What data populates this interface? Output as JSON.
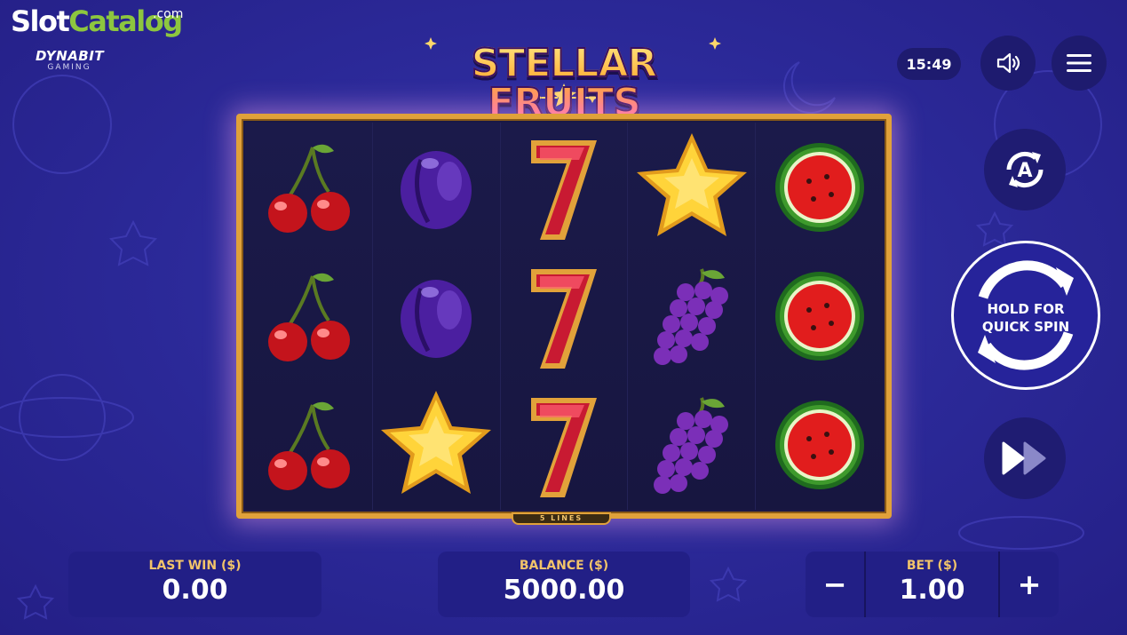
{
  "watermark": {
    "slot": "Slot",
    "catalog": "Catalog",
    "com": ".com"
  },
  "provider": {
    "name": "DYNABIT",
    "sub": "GAMING"
  },
  "game": {
    "title": "STELLAR FRUITS"
  },
  "clock": {
    "time": "15:49"
  },
  "controls": {
    "spin_label_line1": "HOLD FOR",
    "spin_label_line2": "QUICK SPIN"
  },
  "reels": {
    "lines_label": "5 LINES",
    "grid": [
      [
        "cherry",
        "plum",
        "seven",
        "star",
        "watermelon"
      ],
      [
        "cherry",
        "plum",
        "seven",
        "grapes",
        "watermelon"
      ],
      [
        "cherry",
        "star",
        "seven",
        "grapes",
        "watermelon"
      ]
    ]
  },
  "panels": {
    "last_win_label": "LAST WIN ($)",
    "last_win_value": "0.00",
    "balance_label": "BALANCE ($)",
    "balance_value": "5000.00",
    "bet_label": "BET ($)",
    "bet_value": "1.00",
    "bet_minus": "−",
    "bet_plus": "+"
  },
  "colors": {
    "background": "#2c2a9a",
    "panel": "#221f86",
    "gold": "#e0a13a",
    "label": "#f2c46a"
  }
}
